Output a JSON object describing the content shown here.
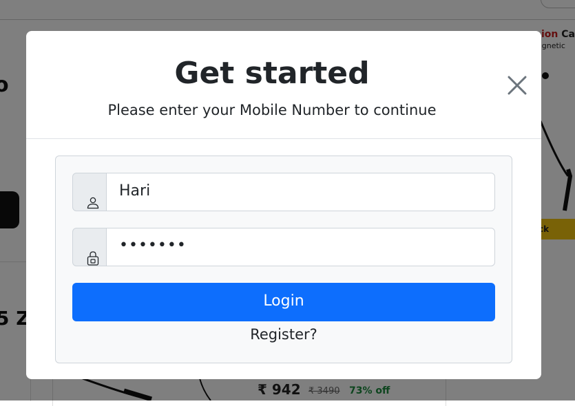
{
  "background": {
    "right_card": {
      "title_red": "ion",
      "title_dark": " Ca",
      "subtitle": "agnetic",
      "button_fragment": "ck"
    },
    "left_fragments": {
      "top": "o",
      "bottom": "5 Z"
    },
    "product": {
      "price": "₹ 942",
      "mrp": "₹ 3490",
      "discount": "73% off"
    }
  },
  "modal": {
    "title": "Get started",
    "subtitle": "Please enter your Mobile Number to continue",
    "close_icon": "close-icon",
    "username": {
      "value": "Hari",
      "icon": "user-icon"
    },
    "password": {
      "masked_value": "•••••••",
      "icon": "lock-icon"
    },
    "login_label": "Login",
    "register_label": "Register?"
  },
  "colors": {
    "primary": "#0d6efd",
    "overlay": "rgba(0,0,0,0.5)",
    "discount_green": "#1a8a3c",
    "brand_red": "#c91f1f",
    "yellow_button": "#f2c40f"
  }
}
